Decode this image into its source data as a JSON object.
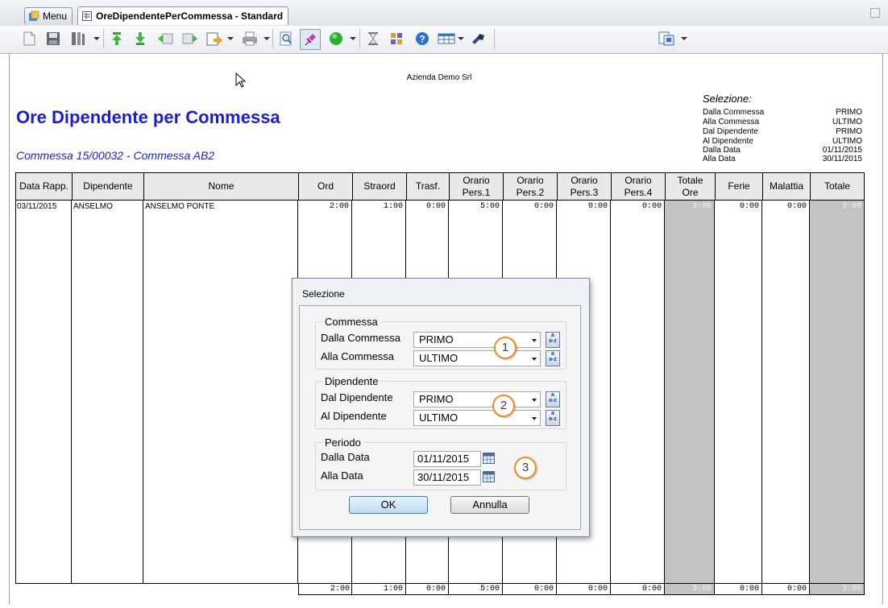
{
  "tabs": [
    {
      "label": "Menu"
    },
    {
      "label": "OreDipendentePerCommessa - Standard"
    }
  ],
  "report": {
    "company": "Azienda Demo Srl",
    "title": "Ore Dipendente per Commessa",
    "subtitle": "Commessa 15/00032 -  Commessa AB2",
    "selection": {
      "heading": "Selezione:",
      "rows": [
        {
          "label": "Dalla Commessa",
          "value": "PRIMO"
        },
        {
          "label": "Alla Commessa",
          "value": "ULTIMO"
        },
        {
          "label": "Dal Dipendente",
          "value": "PRIMO"
        },
        {
          "label": "Al Dipendente",
          "value": "ULTIMO"
        },
        {
          "label": "Dalla Data",
          "value": "01/11/2015"
        },
        {
          "label": "Alla Data",
          "value": "30/11/2015"
        }
      ]
    }
  },
  "table": {
    "headers": [
      "Data Rapp.",
      "Dipendente",
      "Nome",
      "Ord",
      "Straord",
      "Trasf.",
      "Orario Pers.1",
      "Orario Pers.2",
      "Orario Pers.3",
      "Orario Pers.4",
      "Totale Ore",
      "Ferie",
      "Malattia",
      "Totale"
    ],
    "row": [
      "03/11/2015",
      "ANSELMO",
      "ANSELMO PONTE",
      "2:00",
      "1:00",
      "0:00",
      "5:00",
      "0:00",
      "0:00",
      "0:00",
      "3:00",
      "0:00",
      "0:00",
      "3:00"
    ],
    "totals": [
      "2:00",
      "1:00",
      "0:00",
      "5:00",
      "0:00",
      "0:00",
      "0:00",
      "3:00",
      "0:00",
      "0:00",
      "3:00"
    ]
  },
  "dialog": {
    "title": "Selezione",
    "commessa": {
      "group": "Commessa",
      "from_label": "Dalla Commessa",
      "from_value": "PRIMO",
      "to_label": "Alla Commessa",
      "to_value": "ULTIMO"
    },
    "dipendente": {
      "group": "Dipendente",
      "from_label": "Dal Dipendente",
      "from_value": "PRIMO",
      "to_label": "Al Dipendente",
      "to_value": "ULTIMO"
    },
    "periodo": {
      "group": "Periodo",
      "from_label": "Dalla Data",
      "from_value": "01/11/2015",
      "to_label": "Alla Data",
      "to_value": "30/11/2015"
    },
    "az_label_top": "a",
    "az_label_bottom": "a-z",
    "ok_label": "OK",
    "cancel_label": "Annulla",
    "badges": [
      "1",
      "2",
      "3"
    ]
  },
  "colors": {
    "title_blue": "#1c1cd1",
    "grey_column": "#c3c3c3",
    "badge_orange": "#f08a24"
  }
}
